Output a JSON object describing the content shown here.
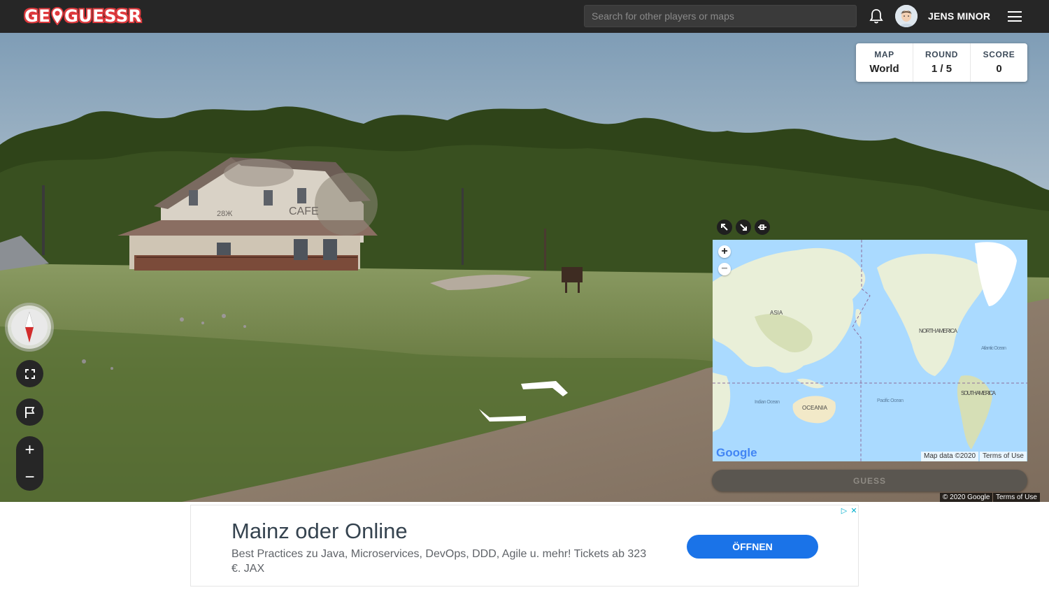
{
  "header": {
    "logo_text_1": "GE",
    "logo_text_2": "GUESSR",
    "search_placeholder": "Search for other players or maps",
    "username": "JENS MINOR"
  },
  "game_status": {
    "map_label": "MAP",
    "map_value": "World",
    "round_label": "ROUND",
    "round_value": "1 / 5",
    "score_label": "SCORE",
    "score_value": "0"
  },
  "streetview": {
    "sign_text": "CAFE",
    "sign_text_2": "28Ж",
    "footer_copyright": "© 2020 Google",
    "footer_terms": "Terms of Use"
  },
  "minimap": {
    "labels": {
      "asia": "ASIA",
      "north_america": "NORTH AMERICA",
      "south_america": "SOUTH AMERICA",
      "oceania": "OCEANIA",
      "atlantic": "Atlantic Ocean",
      "pacific": "Pacific Ocean",
      "indian": "Indian Ocean"
    },
    "google_logo": "Google",
    "map_data": "Map data ©2020",
    "terms": "Terms of Use",
    "zoom_in": "+",
    "zoom_out": "−"
  },
  "controls": {
    "guess_label": "GUESS",
    "zoom_in": "+",
    "zoom_out": "−"
  },
  "ad": {
    "title": "Mainz oder Online",
    "text": "Best Practices zu Java, Microservices, DevOps, DDD, Agile u. mehr! Tickets ab 323 €. JAX",
    "button": "ÖFFNEN"
  },
  "colors": {
    "brand_red": "#e03a3e",
    "header_bg": "#262626",
    "ad_button": "#1a73e8"
  }
}
